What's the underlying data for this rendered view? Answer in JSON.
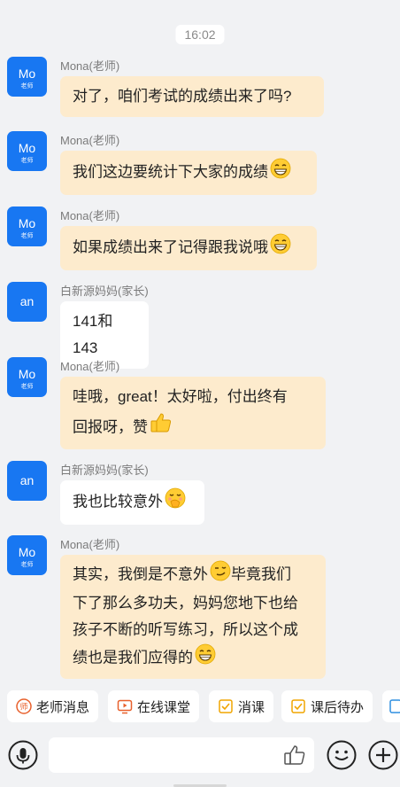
{
  "chat": {
    "timestamp": "16:02",
    "messages": [
      {
        "avatar": "Mo",
        "avatar_sub": "老师",
        "sender": "Mona(老师)",
        "lines": [
          "对了，咱们考试的成绩出来了吗?"
        ]
      },
      {
        "avatar": "Mo",
        "avatar_sub": "老师",
        "sender": "Mona(老师)",
        "lines": [
          "我们这边要统计下大家的成绩"
        ],
        "emoji": "grin-emoji"
      },
      {
        "avatar": "Mo",
        "avatar_sub": "老师",
        "sender": "Mona(老师)",
        "lines": [
          "如果成绩出来了记得跟我说哦"
        ],
        "emoji": "grin-emoji"
      },
      {
        "avatar": "an",
        "sender": "白新源妈妈(家长)",
        "lines": [
          "141和143"
        ]
      },
      {
        "avatar": "Mo",
        "avatar_sub": "老师",
        "sender": "Mona(老师)",
        "lines": [
          "哇哦，great！太好啦，付出终有",
          "回报呀，赞"
        ],
        "emoji": "thumbs-up-emoji"
      },
      {
        "avatar": "an",
        "sender": "白新源妈妈(家长)",
        "lines": [
          "我也比较意外"
        ],
        "emoji": "hand-over-mouth-emoji"
      },
      {
        "avatar": "Mo",
        "avatar_sub": "老师",
        "sender": "Mona(老师)",
        "lines": [
          "其实，我倒是不意外",
          "下了那么多功夫，妈妈您地下也给",
          "孩子不断的听写练习，所以这个成",
          "绩也是我们应得的"
        ],
        "line0_tail": "毕竟我们"
      }
    ]
  },
  "toolbar": {
    "items": [
      {
        "label": "老师消息",
        "icon": "teacher-icon"
      },
      {
        "label": "在线课堂",
        "icon": "online-class-icon"
      },
      {
        "label": "消课",
        "icon": "checkbox-icon"
      },
      {
        "label": "课后待办",
        "icon": "checkbox-icon"
      }
    ]
  },
  "input": {
    "placeholder": ""
  },
  "colors": {
    "teacher_bubble": "#fdebcd",
    "parent_bubble": "#ffffff",
    "avatar": "#1877f2",
    "accent": "#e8602c"
  }
}
